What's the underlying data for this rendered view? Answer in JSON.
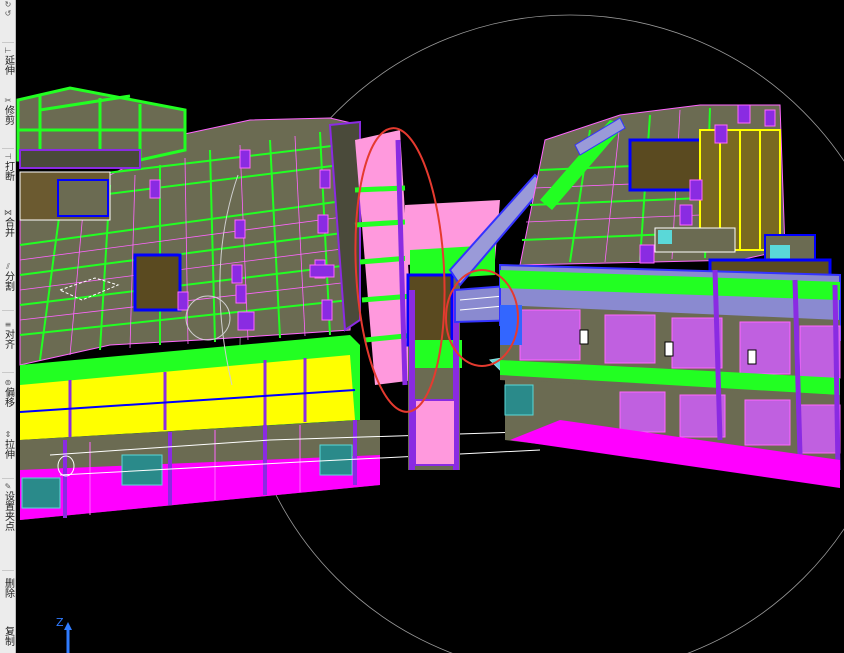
{
  "toolbar": {
    "tools": [
      {
        "label": "延伸",
        "icon": "extend-icon"
      },
      {
        "label": "修剪",
        "icon": "trim-icon"
      },
      {
        "label": "打断",
        "icon": "break-icon"
      },
      {
        "label": "合并",
        "icon": "merge-icon"
      },
      {
        "label": "分割",
        "icon": "split-icon"
      },
      {
        "label": "对齐",
        "icon": "align-icon"
      },
      {
        "label": "偏移",
        "icon": "offset-icon"
      },
      {
        "label": "拉伸",
        "icon": "stretch-icon"
      },
      {
        "label": "设置夹点",
        "icon": "grip-icon"
      },
      {
        "label": "删除",
        "icon": "delete-icon"
      },
      {
        "label": "复制",
        "icon": "copy-icon"
      }
    ]
  },
  "viewport": {
    "axis_label": "Z",
    "colors": {
      "background": "#000000",
      "slab": "#6b6b52",
      "beam": "#22ff22",
      "edge": "#ff66ff",
      "column": "#8a2be2",
      "wall_yellow": "#ffff00",
      "magenta": "#ff00ff",
      "annotation": "#e53a2f",
      "stair": "#5ad8d8",
      "blue_outline": "#0000ff"
    }
  }
}
